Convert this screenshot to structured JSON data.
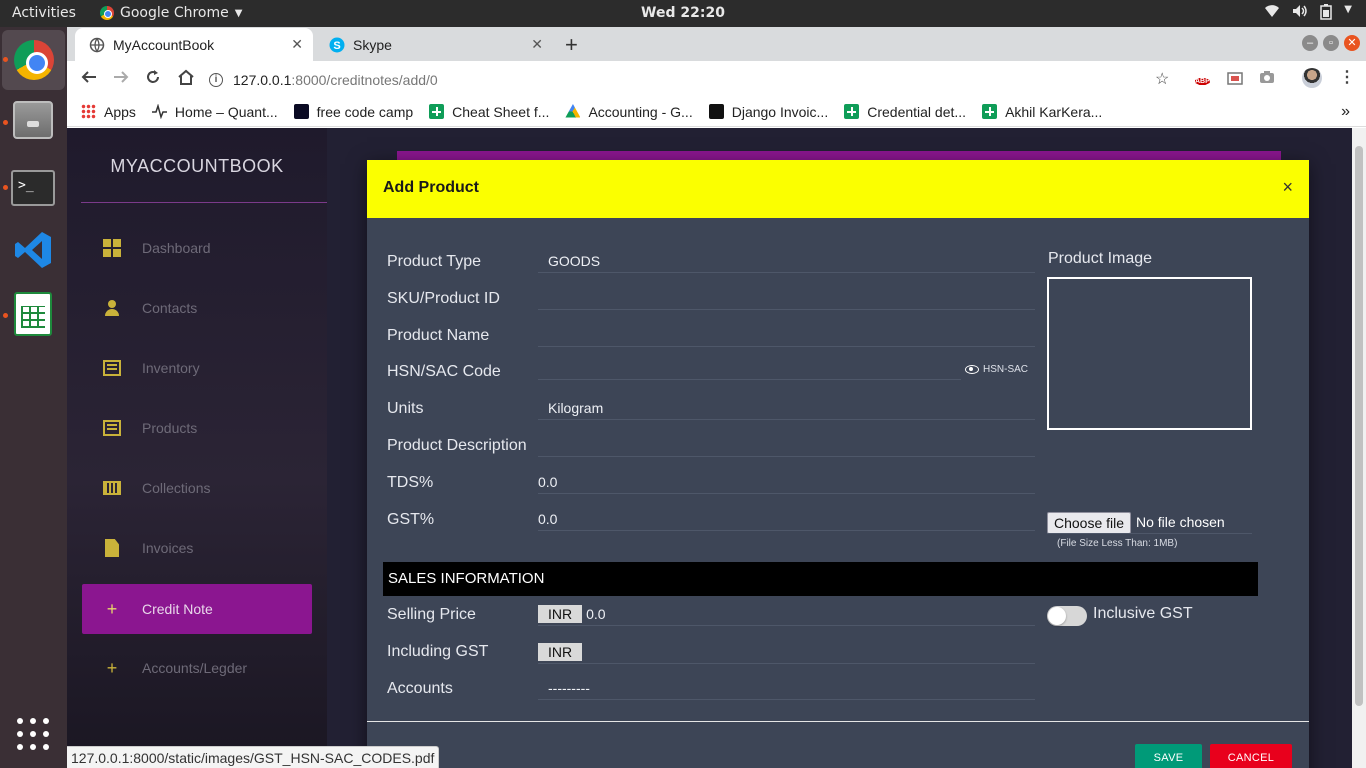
{
  "topbar": {
    "activities": "Activities",
    "app_name": "Google Chrome",
    "clock": "Wed 22:20"
  },
  "browser": {
    "tabs": [
      {
        "title": "MyAccountBook",
        "active": true
      },
      {
        "title": "Skype",
        "active": false
      }
    ],
    "url_host": "127.0.0.1",
    "url_rest": ":8000/creditnotes/add/0",
    "bookmarks": [
      {
        "label": "Apps",
        "icon": "apps-icon"
      },
      {
        "label": "Home – Quant...",
        "icon": "pulse-icon"
      },
      {
        "label": "free code camp",
        "icon": "fcc-icon"
      },
      {
        "label": "Cheat Sheet f...",
        "icon": "sheets-icon"
      },
      {
        "label": "Accounting - G...",
        "icon": "drive-icon"
      },
      {
        "label": "Django Invoic...",
        "icon": "django-icon"
      },
      {
        "label": "Credential det...",
        "icon": "sheets-icon"
      },
      {
        "label": "Akhil KarKera...",
        "icon": "sheets-icon"
      }
    ],
    "status_url": "127.0.0.1:8000/static/images/GST_HSN-SAC_CODES.pdf"
  },
  "sidebar": {
    "brand": "MYACCOUNTBOOK",
    "items": [
      {
        "label": "Dashboard",
        "icon": "dashboard-icon"
      },
      {
        "label": "Contacts",
        "icon": "person-icon"
      },
      {
        "label": "Inventory",
        "icon": "inventory-icon"
      },
      {
        "label": "Products",
        "icon": "products-icon"
      },
      {
        "label": "Collections",
        "icon": "collections-icon"
      },
      {
        "label": "Invoices",
        "icon": "invoices-icon"
      },
      {
        "label": "Credit Note",
        "icon": "plus-icon",
        "active": true
      },
      {
        "label": "Accounts/Legder",
        "icon": "plus-icon"
      }
    ]
  },
  "modal": {
    "title": "Add Product",
    "close": "×",
    "fields": {
      "product_type": {
        "label": "Product Type",
        "value": "GOODS"
      },
      "sku": {
        "label": "SKU/Product ID",
        "value": ""
      },
      "product_name": {
        "label": "Product Name",
        "value": ""
      },
      "hsn": {
        "label": "HSN/SAC Code",
        "value": "",
        "link": "HSN-SAC"
      },
      "units": {
        "label": "Units",
        "value": "Kilogram"
      },
      "description": {
        "label": "Product Description",
        "value": ""
      },
      "tds": {
        "label": "TDS%",
        "value": "0.0"
      },
      "gst": {
        "label": "GST%",
        "value": "0.0"
      }
    },
    "image": {
      "label": "Product Image",
      "choose_button": "Choose file",
      "file_status": "No file chosen",
      "size_note": "(File Size Less Than: 1MB)"
    },
    "sales": {
      "header": "SALES INFORMATION",
      "selling_price": {
        "label": "Selling Price",
        "currency": "INR",
        "value": "0.0"
      },
      "including_gst": {
        "label": "Including GST",
        "currency": "INR",
        "value": ""
      },
      "accounts": {
        "label": "Accounts",
        "value": "---------"
      },
      "inclusive_gst": {
        "label": "Inclusive GST",
        "on": false
      }
    },
    "save": "SAVE",
    "cancel": "CANCEL"
  },
  "colors": {
    "modal_header": "#fbff00",
    "modal_body": "#3d4556",
    "sidebar_active": "#8b1690",
    "save": "#009a78",
    "cancel": "#e8001c"
  }
}
